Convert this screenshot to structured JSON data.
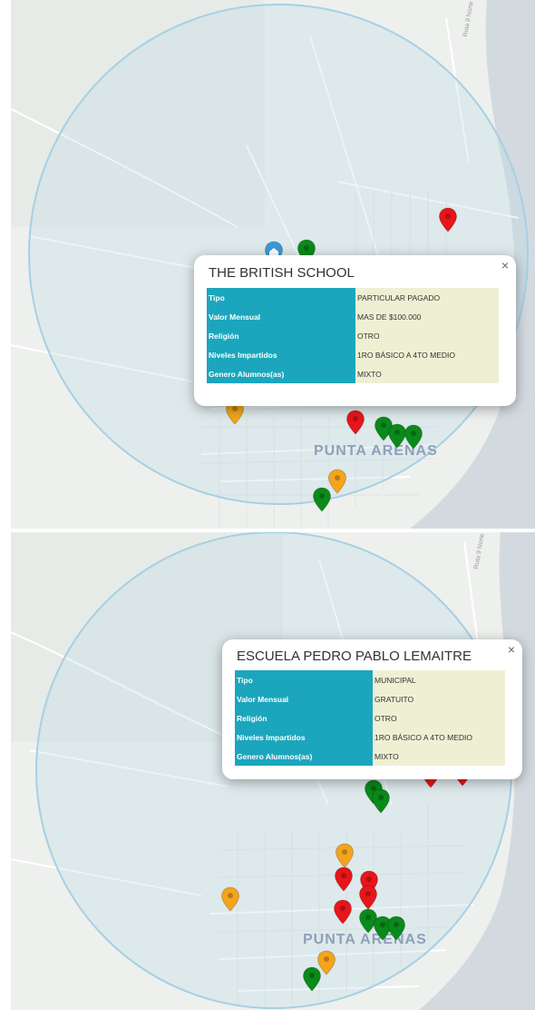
{
  "city_label": "PUNTA ARENAS",
  "road_label": "Ruta 9 Norte",
  "colors": {
    "particular": "#e8151a",
    "municipal": "#0a8a1a",
    "subvencionado": "#f4a41c",
    "home": "#3b99d6",
    "table_key": "#1ba6bd",
    "table_value": "#efefd3"
  },
  "panel1": {
    "popup": {
      "title": "THE BRITISH SCHOOL",
      "close": "×",
      "rows": [
        {
          "key": "Tipo",
          "value": "PARTICULAR PAGADO"
        },
        {
          "key": "Valor Mensual",
          "value": "MAS DE $100.000"
        },
        {
          "key": "Religión",
          "value": "OTRO"
        },
        {
          "key": "Niveles Impartidos",
          "value": "1RO BÁSICO A 4TO MEDIO"
        },
        {
          "key": "Genero Alumnos(as)",
          "value": "MIXTO"
        }
      ]
    }
  },
  "panel2": {
    "popup": {
      "title": "ESCUELA PEDRO PABLO LEMAITRE",
      "close": "×",
      "rows": [
        {
          "key": "Tipo",
          "value": "MUNICIPAL"
        },
        {
          "key": "Valor Mensual",
          "value": "GRATUITO"
        },
        {
          "key": "Religión",
          "value": "OTRO"
        },
        {
          "key": "Niveles Impartidos",
          "value": "1RO BÁSICO A 4TO MEDIO"
        },
        {
          "key": "Genero Alumnos(as)",
          "value": "MIXTO"
        }
      ]
    }
  }
}
